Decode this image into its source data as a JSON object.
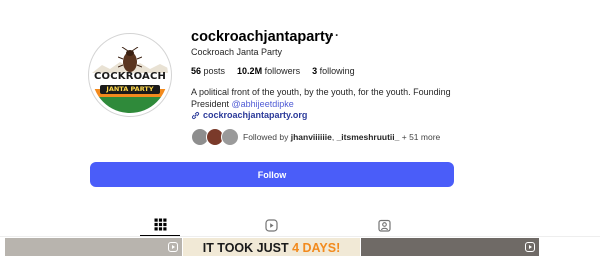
{
  "profile": {
    "username": "cockroachjantaparty",
    "more_label": "···",
    "full_name": "Cockroach Janta Party",
    "logo_line1": "COCKROACH",
    "logo_line2": "JANTA PARTY"
  },
  "stats": {
    "posts_count": "56",
    "posts_label": "posts",
    "followers_count": "10.2M",
    "followers_label": "followers",
    "following_count": "3",
    "following_label": "following"
  },
  "bio": {
    "text": "A political front of the youth, by the youth, for the youth. Founding President ",
    "mention": "@abhijeetdipke",
    "link": "cockroachjantaparty.org"
  },
  "followed_by": {
    "prefix": "Followed by ",
    "user1": "jhanviiiiiie",
    "sep": ", ",
    "user2": "_itsmeshruutii_",
    "suffix": " + 51 more"
  },
  "actions": {
    "follow_label": "Follow"
  },
  "tabs": [
    {
      "name": "posts",
      "icon": "grid-icon",
      "active": true
    },
    {
      "name": "reels",
      "icon": "reels-icon",
      "active": false
    },
    {
      "name": "tagged",
      "icon": "tagged-icon",
      "active": false
    }
  ],
  "posts": {
    "post2_text_a": "IT TOOK JUST ",
    "post2_text_b": "4 DAYS!"
  },
  "colors": {
    "accent": "#4a5df9",
    "mention": "#4f5bd5",
    "saffron": "#f28a1d",
    "green": "#2f8a3a"
  }
}
